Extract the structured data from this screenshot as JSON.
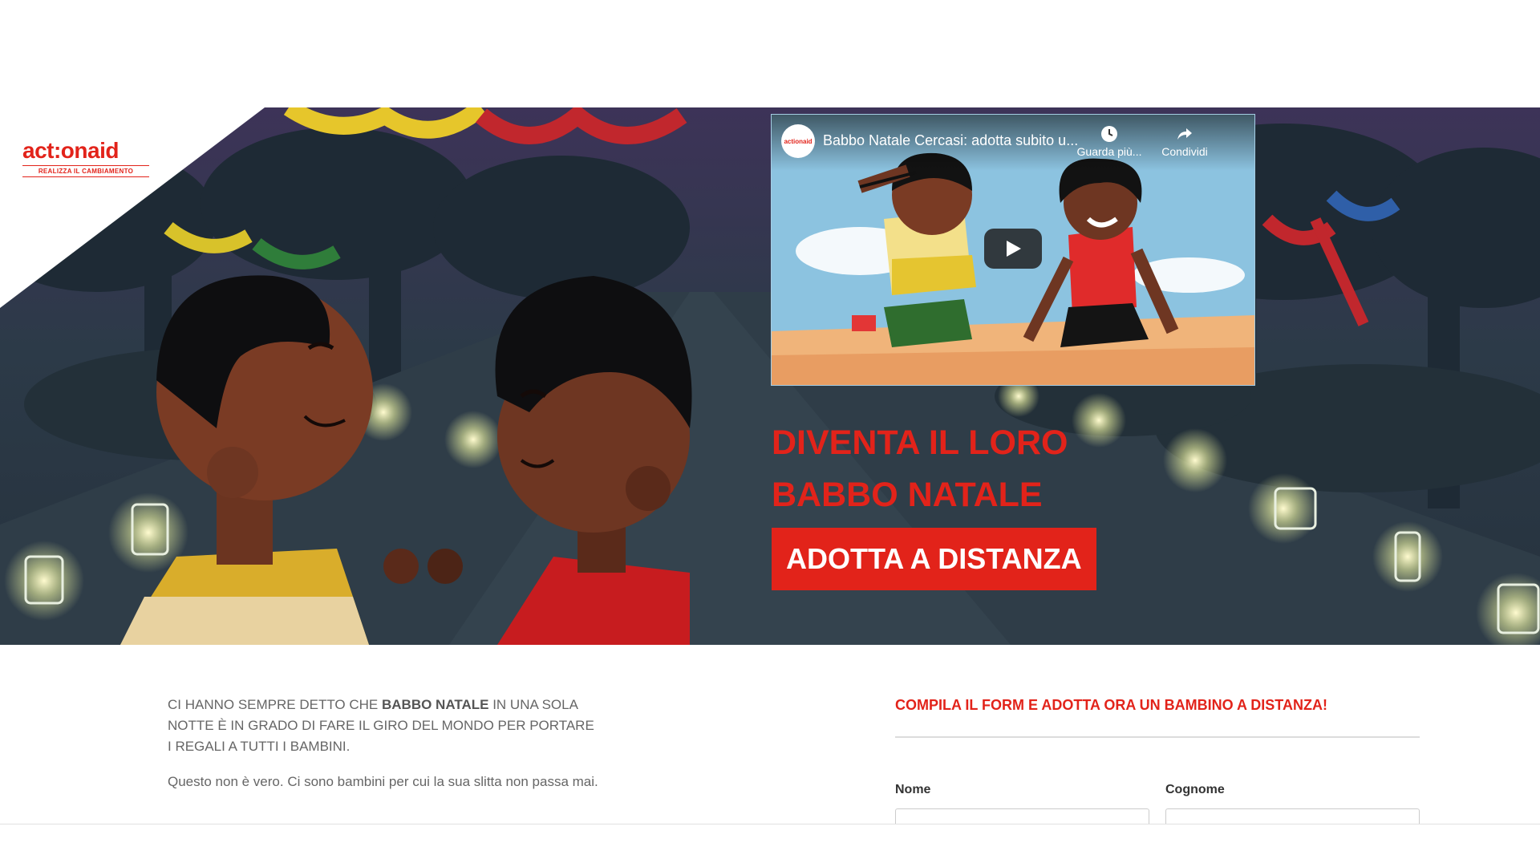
{
  "brand": {
    "logo_text": "act:onaid",
    "tagline": "REALIZZA IL CAMBIAMENTO",
    "accent_color": "#e2231a"
  },
  "video": {
    "channel": "actionaid",
    "title": "Babbo Natale Cercasi: adotta subito u...",
    "watch_later_label": "Guarda più...",
    "share_label": "Condividi",
    "icons": [
      "clock-icon",
      "share-icon",
      "play-icon"
    ]
  },
  "hero": {
    "headline_line1": "DIVENTA IL LORO",
    "headline_line2": "BABBO NATALE",
    "cta_label": "ADOTTA A DISTANZA"
  },
  "intro": {
    "p1_pre": "CI HANNO SEMPRE DETTO CHE ",
    "p1_bold": "BABBO NATALE",
    "p1_post": " IN UNA SOLA NOTTE È IN GRADO DI FARE IL GIRO DEL MONDO PER PORTARE I REGALI A TUTTI I BAMBINI.",
    "p2": "Questo non è vero. Ci sono bambini per cui la sua slitta non passa mai."
  },
  "form": {
    "title": "COMPILA IL FORM E ADOTTA ORA UN BAMBINO A DISTANZA!",
    "first_name_label": "Nome",
    "last_name_label": "Cognome",
    "first_name_value": "",
    "last_name_value": ""
  }
}
